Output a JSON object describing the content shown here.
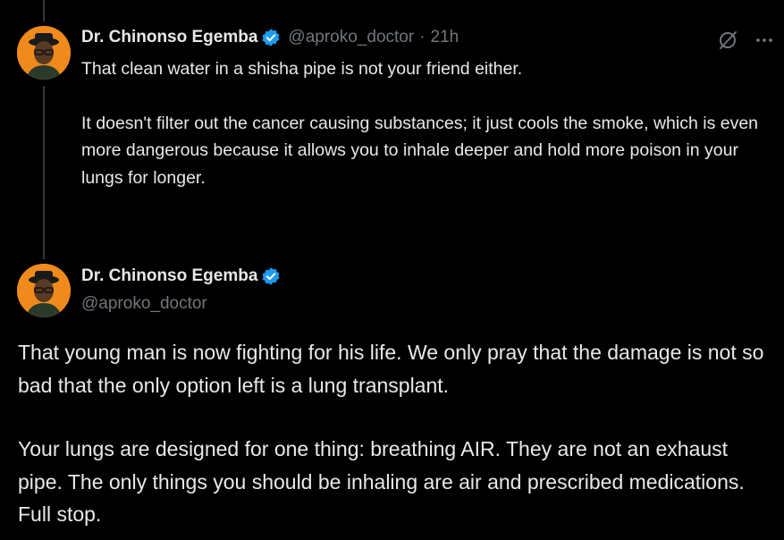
{
  "tweet1": {
    "author_name": "Dr. Chinonso Egemba",
    "handle": "@aproko_doctor",
    "separator": "·",
    "time": "21h",
    "paragraphs": [
      "That clean water in a shisha pipe is not your friend either.",
      "It doesn't filter out the cancer causing substances; it just cools the smoke, which is even more dangerous because it allows you to inhale deeper and hold more poison in your lungs for longer."
    ]
  },
  "tweet2": {
    "author_name": "Dr. Chinonso Egemba",
    "handle": "@aproko_doctor",
    "paragraphs": [
      "That young man is now fighting for his life. We only pray that the damage is not so bad that the only option left is a lung transplant.",
      "Your lungs are designed for one thing: breathing AIR. They are not an exhaust pipe. The only things you should be inhaling are air and prescribed medications. Full stop."
    ]
  },
  "icons": {
    "verified": "verified-badge-icon",
    "grok": "grok-icon",
    "more": "more-icon"
  },
  "colors": {
    "background": "#000000",
    "text": "#e7e9ea",
    "secondary": "#71767b",
    "verified": "#1d9bf0",
    "avatar_bg": "#f08a1d",
    "thread_line": "#333639"
  }
}
